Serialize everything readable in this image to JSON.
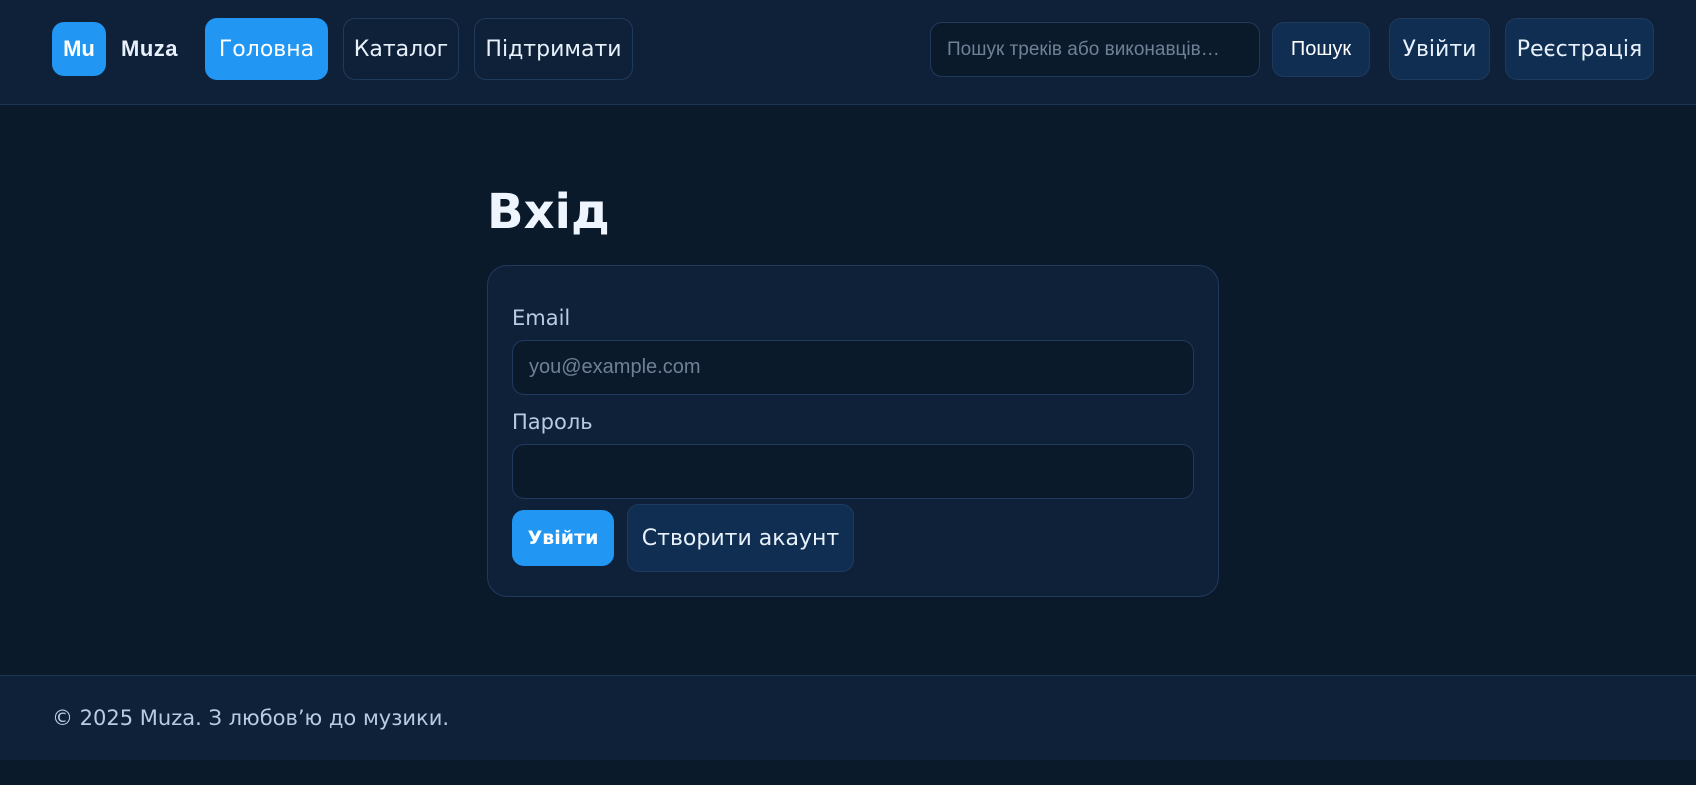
{
  "header": {
    "logo_badge": "Mu",
    "logo_text": "Muza",
    "nav": [
      {
        "label": "Головна",
        "active": true
      },
      {
        "label": "Каталог",
        "active": false
      },
      {
        "label": "Підтримати",
        "active": false
      }
    ],
    "search": {
      "placeholder": "Пошук треків або виконавців…",
      "value": "",
      "button_label": "Пошук"
    },
    "login_label": "Увійти",
    "register_label": "Реєстрація"
  },
  "main": {
    "title": "Вхід",
    "form": {
      "email_label": "Email",
      "email_placeholder": "you@example.com",
      "email_value": "",
      "password_label": "Пароль",
      "password_value": "",
      "submit_label": "Увійти",
      "create_account_label": "Створити акаунт"
    }
  },
  "footer": {
    "text": "© 2025 Muza. З любов’ю до музики."
  },
  "colors": {
    "accent": "#2196f3",
    "background": "#0a1a2b",
    "surface": "#0f2139",
    "border": "#1f3a5c"
  }
}
